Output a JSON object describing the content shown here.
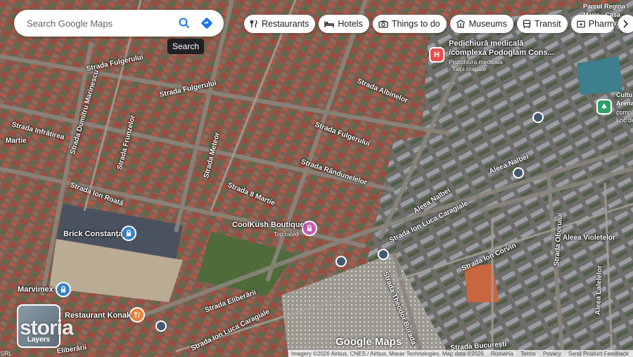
{
  "search": {
    "placeholder": "Search Google Maps",
    "tooltip": "Search"
  },
  "chips": [
    {
      "label": "Restaurants",
      "icon": "restaurant-icon"
    },
    {
      "label": "Hotels",
      "icon": "hotel-icon"
    },
    {
      "label": "Things to do",
      "icon": "camera-icon"
    },
    {
      "label": "Museums",
      "icon": "museum-icon"
    },
    {
      "label": "Transit",
      "icon": "transit-icon"
    },
    {
      "label": "Pharm",
      "icon": "pharmacy-icon"
    }
  ],
  "streets": [
    "Strada Fulgerului",
    "Strada Fulgerului",
    "Strada Fulgerului",
    "Strada Albinelor",
    "Strada Dumitru Marinescu",
    "Strada Infrătirea",
    "Strada Frunzelor",
    "Strada Meteor",
    "Strada Rândunelelor",
    "Strada 8 Martie",
    "Strada Ion Roată",
    "Aleea Nalbei",
    "Aleea Nalbei",
    "Strada Ion Luca Caragiale",
    "Strada Ion Luca Caragiale",
    "Strada Ion Corvin",
    "Strada Oborului",
    "Aleea Violetelor",
    "Aleea Lalelelor",
    "Strada Theodor Burada",
    "Strada Eliberării",
    "Strada București",
    "Martie",
    "Eliberării"
  ],
  "pois": {
    "brick": "Brick Constanța",
    "coolkush": "CoolKush Boutique",
    "coolkush_sub": "Top rated",
    "pedichiura": "Pedichiură medicală",
    "pedichiura2": "/complexa Podoglam Cons...",
    "pedichiura_sub": "Pedichiura medicala",
    "pedichiura_sub2": "- Talpi crapate",
    "marvimex": "Marvimex",
    "konak": "Restaurant Konak",
    "cultu": "Cultu",
    "arena": "Arena",
    "complex": "comple",
    "loc": "Loc de",
    "parc": "Parcul Regina",
    "casa": "Maria - Casa",
    "cultura": "Cultură"
  },
  "layers_label": "Layers",
  "watermark": "storia",
  "logo": "Google Maps",
  "footer": [
    "Imagery ©2026 Airbus, CNES / Airbus, Maxar Technologies, Map data ©2026",
    "Romania",
    "Terms",
    "Privacy",
    "Send Product Feedback"
  ],
  "corner_text": "SRL",
  "colors": {
    "accent": "#1a73e8",
    "pin_blue": "#3b82c4",
    "pin_red": "#e94e4e",
    "pin_pink": "#c75bb5",
    "pin_orange": "#e8833a",
    "pin_green": "#2f9e67"
  }
}
